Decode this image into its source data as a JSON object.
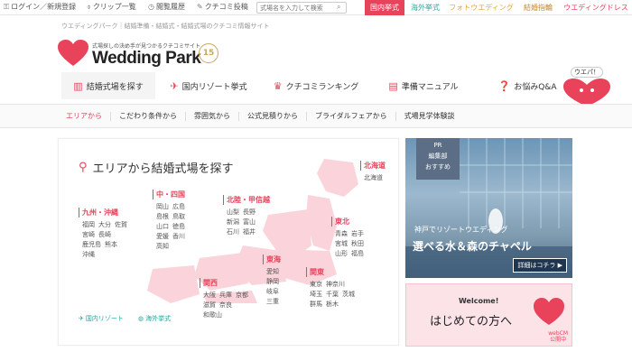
{
  "topbar": {
    "login": "ログイン／新規登録",
    "clip": "クリップ一覧",
    "history": "閲覧履歴",
    "review_post": "クチコミ投稿",
    "search_placeholder": "式場名を入力して検索",
    "tabs": [
      "国内挙式",
      "海外挙式",
      "フォトウエディング",
      "結婚指輪",
      "ウエディングドレス"
    ]
  },
  "tagline": "ウエディングパーク｜結婚準備・結婚式・結婚式場のクチコミ情報サイト",
  "logo": {
    "small": "式場探しの決め手が見つかるクチコミサイト",
    "name": "Wedding Park",
    "anniv": "15"
  },
  "mainnav": [
    {
      "label": "結婚式場を探す",
      "icon": "building-icon"
    },
    {
      "label": "国内リゾート挙式",
      "icon": "airplane-icon"
    },
    {
      "label": "クチコミランキング",
      "icon": "crown-icon"
    },
    {
      "label": "準備マニュアル",
      "icon": "book-icon"
    },
    {
      "label": "お悩みQ&A",
      "icon": "question-icon"
    }
  ],
  "mascot": {
    "bubble": "ウエパ！"
  },
  "subnav": [
    "エリアから",
    "こだわり条件から",
    "雰囲気から",
    "公式見積りから",
    "ブライダルフェアから",
    "式場見学体験談"
  ],
  "area": {
    "title": "エリアから結婚式場を探す",
    "regions": [
      {
        "name": "北海道",
        "prefs": [
          "北海道"
        ]
      },
      {
        "name": "東北",
        "prefs": [
          "青森",
          "岩手",
          "宮城",
          "秋田",
          "山形",
          "福島"
        ]
      },
      {
        "name": "北陸・甲信越",
        "prefs": [
          "山梨",
          "長野",
          "新潟",
          "富山",
          "石川",
          "福井"
        ]
      },
      {
        "name": "関東",
        "prefs": [
          "東京",
          "神奈川",
          "埼玉",
          "千葉",
          "茨城",
          "群馬",
          "栃木"
        ]
      },
      {
        "name": "東海",
        "prefs": [
          "愛知",
          "静岡",
          "岐阜",
          "三重"
        ]
      },
      {
        "name": "関西",
        "prefs": [
          "大阪",
          "兵庫",
          "京都",
          "滋賀",
          "奈良",
          "和歌山"
        ]
      },
      {
        "name": "中・四国",
        "prefs": [
          "岡山",
          "広島",
          "島根",
          "鳥取",
          "山口",
          "徳島",
          "愛媛",
          "香川",
          "高知"
        ]
      },
      {
        "name": "九州・沖縄",
        "prefs": [
          "福岡",
          "大分",
          "佐賀",
          "宮崎",
          "長崎",
          "鹿児島",
          "熊本",
          "沖縄"
        ]
      }
    ],
    "resort_link": "国内リゾート",
    "overseas_link": "海外挙式"
  },
  "banner1": {
    "badge_pr": "PR",
    "badge_1": "編集部",
    "badge_2": "おすすめ",
    "line1": "神戸でリゾートウエディング",
    "line2": "選べる水＆森のチャペル",
    "cta": "詳細はコチラ ▶"
  },
  "banner2": {
    "welcome": "Welcome!",
    "main": "はじめての方へ",
    "cm_1": "webCM",
    "cm_2": "公開中"
  },
  "colors": {
    "accent": "#e8435b",
    "link": "#2aa6a0"
  }
}
